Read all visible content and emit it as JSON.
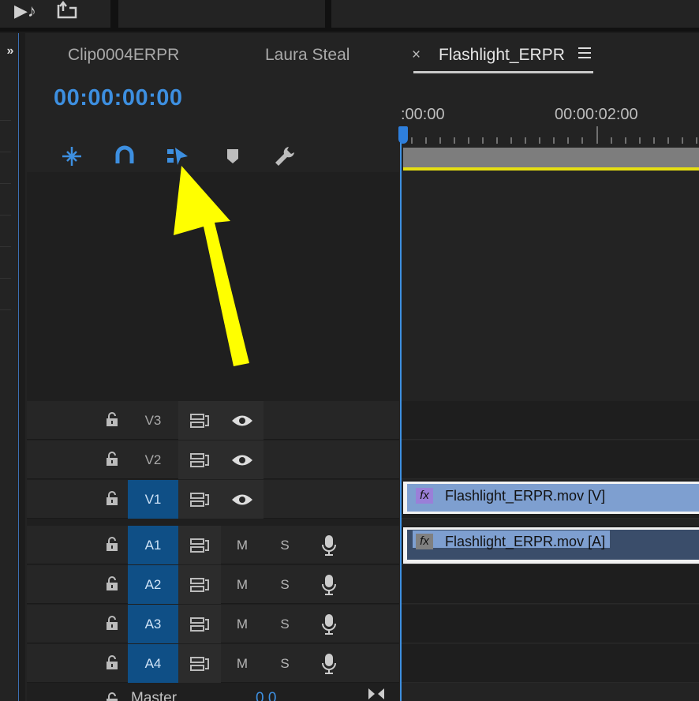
{
  "tabs": [
    {
      "label": "Clip0004ERPR"
    },
    {
      "label": "Laura Steal"
    },
    {
      "label": "Flashlight_ERPR"
    }
  ],
  "timecode": "00:00:00:00",
  "ruler": {
    "labels": [
      ":00:00",
      "00:00:02:00"
    ]
  },
  "tools": [
    {
      "name": "insert-nest-toggle"
    },
    {
      "name": "snap"
    },
    {
      "name": "linked-selection"
    },
    {
      "name": "add-marker"
    },
    {
      "name": "timeline-settings"
    }
  ],
  "video_tracks": [
    {
      "name": "V3",
      "targeted": false
    },
    {
      "name": "V2",
      "targeted": false
    },
    {
      "name": "V1",
      "targeted": true
    }
  ],
  "audio_tracks": [
    {
      "name": "A1",
      "mute": "M",
      "solo": "S"
    },
    {
      "name": "A2",
      "mute": "M",
      "solo": "S"
    },
    {
      "name": "A3",
      "mute": "M",
      "solo": "S"
    },
    {
      "name": "A4",
      "mute": "M",
      "solo": "S"
    }
  ],
  "clips": {
    "video": {
      "name": "Flashlight_ERPR.mov [V]",
      "fx": "fx"
    },
    "audio": {
      "name": "Flashlight_ERPR.mov [A]",
      "fx": "fx"
    }
  },
  "master": {
    "label": "Master",
    "value": "0.0"
  },
  "colors": {
    "accent_blue": "#3d8fe0",
    "track_target": "#0f4f86",
    "video_clip": "#7e9fd0",
    "audio_clip": "#3a4d6a",
    "workarea": "#7d7d7d",
    "annotation_arrow": "#ffff00"
  },
  "annotation": {
    "type": "arrow",
    "points_to": "linked-selection"
  }
}
